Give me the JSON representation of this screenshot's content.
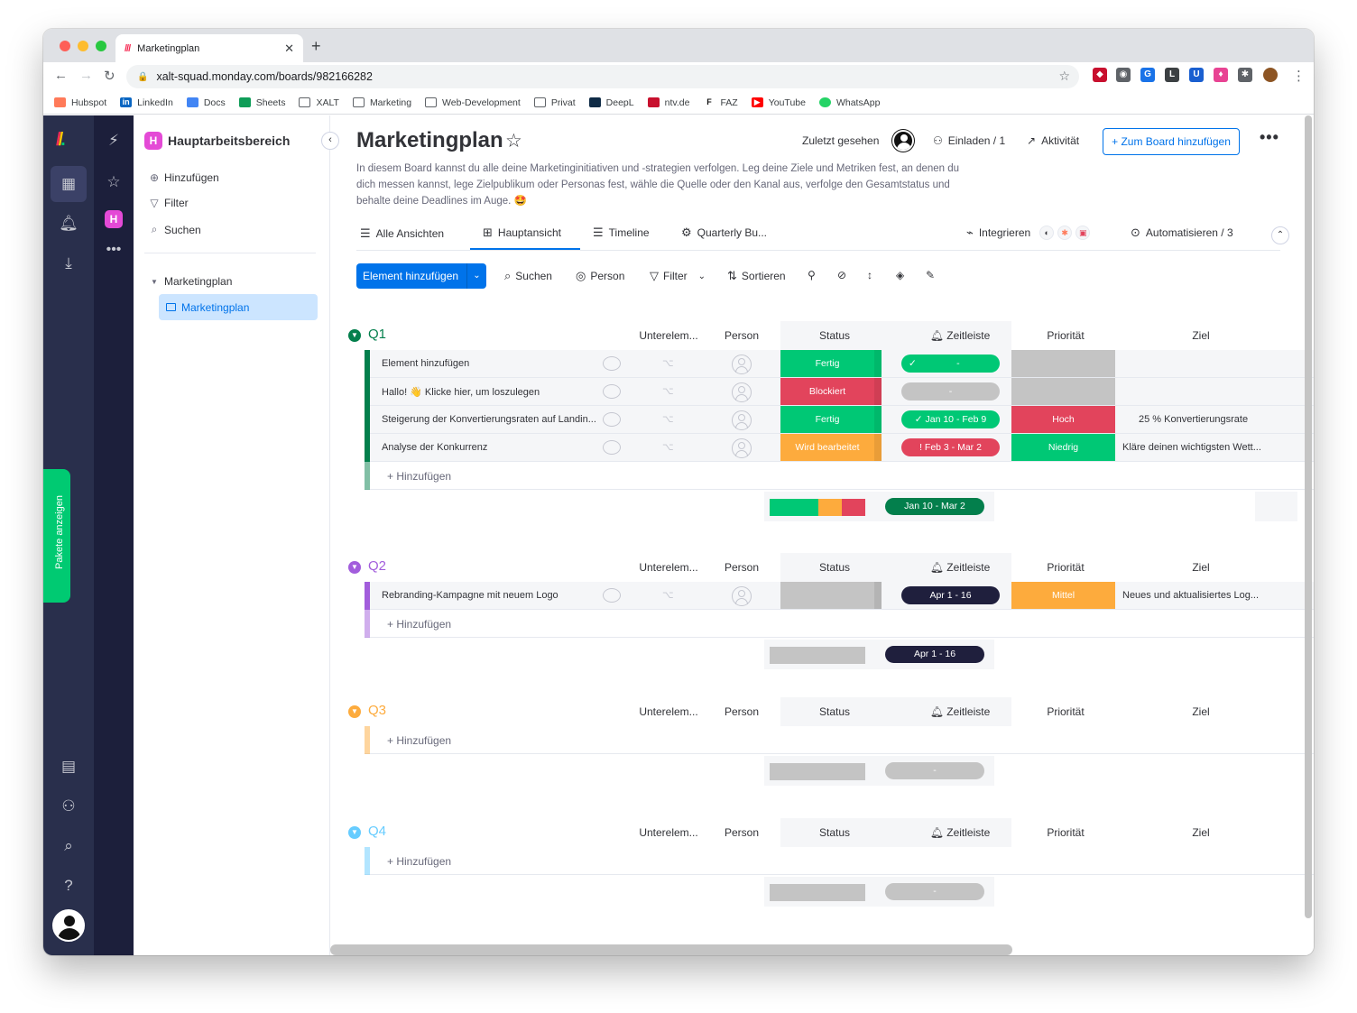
{
  "browser": {
    "tab_title": "Marketingplan",
    "url": "xalt-squad.monday.com/boards/982166282",
    "bookmarks": [
      "Hubspot",
      "LinkedIn",
      "Docs",
      "Sheets",
      "XALT",
      "Marketing",
      "Web-Development",
      "Privat",
      "DeepL",
      "ntv.de",
      "FAZ",
      "YouTube",
      "WhatsApp"
    ]
  },
  "rail": {
    "pakete_label": "Pakete anzeigen",
    "workspace_initial": "H"
  },
  "sidebar": {
    "workspace_name": "Hauptarbeitsbereich",
    "add_label": "Hinzufügen",
    "filter_label": "Filter",
    "search_label": "Suchen",
    "folder_label": "Marketingplan",
    "board_label": "Marketingplan"
  },
  "header": {
    "title": "Marketingplan",
    "description": "In diesem Board kannst du alle deine Marketinginitiativen und -strategien verfolgen. Leg deine Ziele und Metriken fest, an denen du dich messen kannst, lege Zielpublikum oder Personas fest, wähle die Quelle oder den Kanal aus, verfolge den Gesamtstatus und behalte deine Deadlines im Auge. 🤩",
    "last_seen_label": "Zuletzt gesehen",
    "invite_label": "Einladen / 1",
    "activity_label": "Aktivität",
    "add_to_board_label": "+ Zum Board hinzufügen"
  },
  "views": {
    "all_views": "Alle Ansichten",
    "tabs": [
      "Hauptansicht",
      "Timeline",
      "Quarterly Bu..."
    ],
    "integrate_label": "Integrieren",
    "automate_label": "Automatisieren / 3"
  },
  "actions": {
    "add_item_label": "Element hinzufügen",
    "search_label": "Suchen",
    "person_label": "Person",
    "filter_label": "Filter",
    "sort_label": "Sortieren"
  },
  "columns": {
    "sub": "Unterelem...",
    "person": "Person",
    "status": "Status",
    "timeline": "Zeitleiste",
    "priority": "Priorität",
    "goal": "Ziel"
  },
  "add_row_label": "+ Hinzufügen",
  "colors": {
    "done": "#00c875",
    "stuck": "#e2445c",
    "working": "#fdab3d",
    "empty": "#c4c4c4",
    "high": "#e2445c",
    "low": "#00c875",
    "medium": "#fdab3d",
    "dark": "#1f1f3d",
    "blue": "#0073ea"
  },
  "groups": [
    {
      "title": "Q1",
      "color": "#037f4c",
      "rows": [
        {
          "name": "Element hinzufügen",
          "status": "Fertig",
          "timeline": "-",
          "priority": "",
          "goal": ""
        },
        {
          "name": "Hallo! 👋 Klicke hier, um loszulegen",
          "status": "Blockiert",
          "timeline": "-",
          "priority": "",
          "goal": ""
        },
        {
          "name": "Steigerung der Konvertierungsraten auf Landin...",
          "status": "Fertig",
          "timeline": "Jan 10 - Feb 9",
          "priority": "Hoch",
          "goal": "25 % Konvertierungsrate"
        },
        {
          "name": "Analyse der Konkurrenz",
          "status": "Wird bearbeitet",
          "timeline": "Feb 3 - Mar 2",
          "priority": "Niedrig",
          "goal": "Kläre deinen wichtigsten Wett..."
        }
      ],
      "summary_timeline": "Jan 10 - Mar 2"
    },
    {
      "title": "Q2",
      "color": "#a25ddc",
      "rows": [
        {
          "name": "Rebranding-Kampagne mit neuem Logo",
          "status": "",
          "timeline": "Apr 1 - 16",
          "priority": "Mittel",
          "goal": "Neues und aktualisiertes Log..."
        }
      ],
      "summary_timeline": "Apr 1 - 16"
    },
    {
      "title": "Q3",
      "color": "#fdab3d",
      "rows": [],
      "summary_timeline": "-"
    },
    {
      "title": "Q4",
      "color": "#66ccff",
      "rows": [],
      "summary_timeline": "-"
    }
  ]
}
